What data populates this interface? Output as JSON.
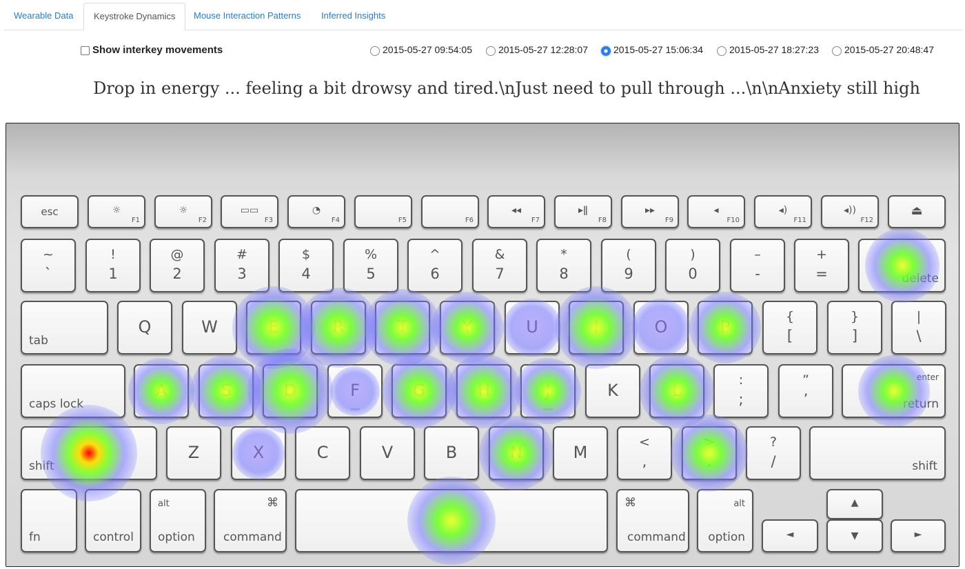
{
  "tabs": [
    "Wearable Data",
    "Keystroke Dynamics",
    "Mouse Interaction Patterns",
    "Inferred Insights"
  ],
  "active_tab": "Keystroke Dynamics",
  "interkey": {
    "label": "Show interkey movements",
    "checked": false
  },
  "sessions": [
    {
      "label": "2015-05-27 09:54:05",
      "selected": false
    },
    {
      "label": "2015-05-27 12:28:07",
      "selected": false
    },
    {
      "label": "2015-05-27 15:06:34",
      "selected": true
    },
    {
      "label": "2015-05-27 18:27:23",
      "selected": false
    },
    {
      "label": "2015-05-27 20:48:47",
      "selected": false
    }
  ],
  "note": "Drop in energy ... feeling a bit drowsy and tired.\\nJust need to pull through ...\\n\\nAnxiety still high",
  "keyboard": {
    "fn_row": [
      "esc",
      "F1",
      "F2",
      "F3",
      "F4",
      "F5",
      "F6",
      "F7",
      "F8",
      "F9",
      "F10",
      "F11",
      "F12"
    ],
    "num_row": [
      [
        "~",
        "`"
      ],
      [
        "!",
        "1"
      ],
      [
        "@",
        "2"
      ],
      [
        "#",
        "3"
      ],
      [
        "$",
        "4"
      ],
      [
        "%",
        "5"
      ],
      [
        "^",
        "6"
      ],
      [
        "&",
        "7"
      ],
      [
        "*",
        "8"
      ],
      [
        "(",
        "9"
      ],
      [
        ")",
        "0"
      ],
      [
        "–",
        "-"
      ],
      [
        "+",
        "="
      ]
    ],
    "delete": "delete",
    "tab": "tab",
    "top_row": [
      "Q",
      "W",
      "E",
      "R",
      "T",
      "Y",
      "U",
      "I",
      "O",
      "P"
    ],
    "top_row_extra": [
      [
        "{",
        "["
      ],
      [
        "}",
        "]"
      ],
      [
        "|",
        "\\"
      ]
    ],
    "caps": "caps lock",
    "home_row": [
      "A",
      "S",
      "D",
      "F",
      "G",
      "H",
      "J",
      "K",
      "L"
    ],
    "home_row_extra": [
      [
        ":",
        ";"
      ],
      [
        "”",
        "’"
      ]
    ],
    "enter": "enter",
    "return": "return",
    "shift": "shift",
    "bottom_row": [
      "Z",
      "X",
      "C",
      "V",
      "B",
      "N",
      "M"
    ],
    "bottom_row_extra": [
      [
        "<",
        ","
      ],
      [
        ">",
        "."
      ],
      [
        "?",
        "/"
      ]
    ],
    "fn": "fn",
    "control": "control",
    "alt": "alt",
    "option": "option",
    "command": "command",
    "cmd_symbol": "⌘",
    "arrows": [
      "▲",
      "◄",
      "▼",
      "►"
    ]
  },
  "heatmap": [
    {
      "key": "delete",
      "intensity": 0.6
    },
    {
      "key": "E",
      "intensity": 0.75
    },
    {
      "key": "R",
      "intensity": 0.7
    },
    {
      "key": "T",
      "intensity": 0.65
    },
    {
      "key": "Y",
      "intensity": 0.55
    },
    {
      "key": "U",
      "intensity": 0.3
    },
    {
      "key": "I",
      "intensity": 0.75
    },
    {
      "key": "O",
      "intensity": 0.3
    },
    {
      "key": "P",
      "intensity": 0.55
    },
    {
      "key": "A",
      "intensity": 0.45
    },
    {
      "key": "S",
      "intensity": 0.55
    },
    {
      "key": "D",
      "intensity": 0.8
    },
    {
      "key": "F",
      "intensity": 0.15
    },
    {
      "key": "G",
      "intensity": 0.6
    },
    {
      "key": "H",
      "intensity": 0.6
    },
    {
      "key": "J",
      "intensity": 0.45
    },
    {
      "key": "L",
      "intensity": 0.6
    },
    {
      "key": "return",
      "intensity": 0.55
    },
    {
      "key": "shift",
      "intensity": 1.0
    },
    {
      "key": "X",
      "intensity": 0.2
    },
    {
      "key": "N",
      "intensity": 0.6
    },
    {
      "key": ">",
      "intensity": 0.65
    },
    {
      "key": "space",
      "intensity": 0.85
    }
  ]
}
